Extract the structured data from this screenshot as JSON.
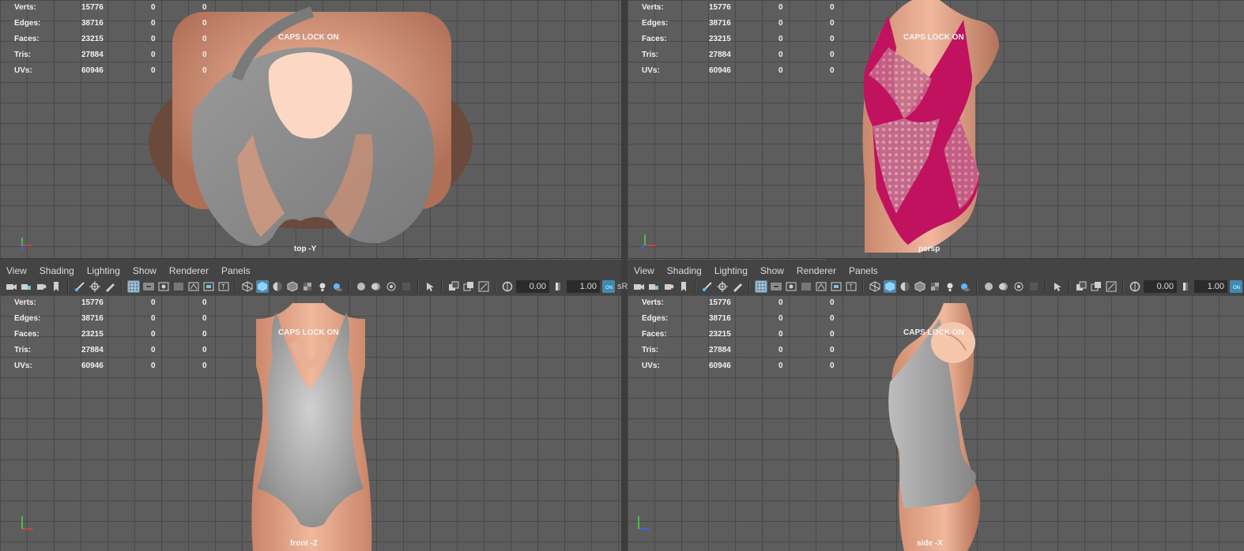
{
  "hud": {
    "labels": [
      "Verts:",
      "Edges:",
      "Faces:",
      "Tris:",
      "UVs:"
    ],
    "values": [
      [
        "15776",
        "0",
        "0"
      ],
      [
        "38716",
        "0",
        "0"
      ],
      [
        "23215",
        "0",
        "0"
      ],
      [
        "27884",
        "0",
        "0"
      ],
      [
        "60946",
        "0",
        "0"
      ]
    ]
  },
  "caps_lock": "CAPS LOCK ON",
  "cameras": {
    "top": "top -Y",
    "persp": "persp",
    "front": "front -Z",
    "side": "side -X"
  },
  "menu": [
    "View",
    "Shading",
    "Lighting",
    "Show",
    "Renderer",
    "Panels"
  ],
  "toolbar": {
    "exposure": "0.00",
    "gamma": "1.00",
    "color_mgmt": "sR"
  },
  "colors": {
    "viewport_bg": "#5d5d5d",
    "grid": "#4a4a4a",
    "skin": "#e8a88c",
    "garment_gray": "#a7a7a7",
    "garment_pink": "#c0125e",
    "toolbar_active": "#5285a6"
  }
}
